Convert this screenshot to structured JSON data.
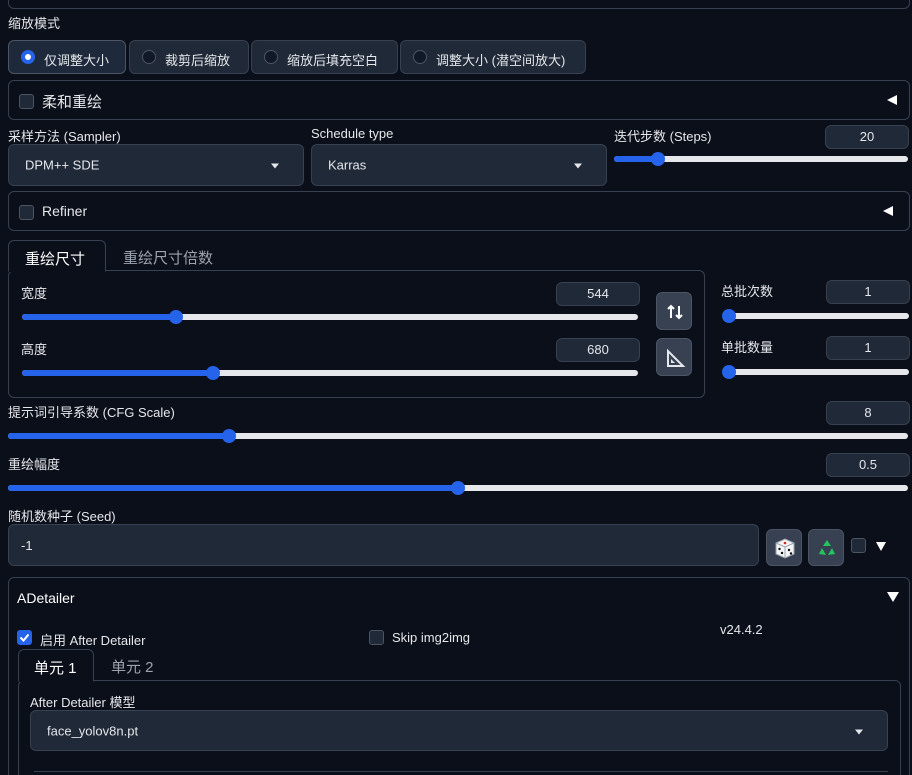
{
  "resize_mode": {
    "label": "缩放模式",
    "options": [
      "仅调整大小",
      "裁剪后缩放",
      "缩放后填充空白",
      "调整大小 (潜空间放大)"
    ],
    "selected": 0
  },
  "soft_inpaint": {
    "label": "柔和重绘",
    "checked": false
  },
  "sampler": {
    "label": "采样方法 (Sampler)",
    "value": "DPM++ SDE"
  },
  "schedule": {
    "label": "Schedule type",
    "value": "Karras"
  },
  "steps": {
    "label": "迭代步数 (Steps)",
    "value": "20",
    "fraction": 0.15
  },
  "refiner": {
    "label": "Refiner",
    "checked": false
  },
  "size_tabs": {
    "tab1": "重绘尺寸",
    "tab2": "重绘尺寸倍数"
  },
  "width": {
    "label": "宽度",
    "value": "544",
    "fraction": 0.25
  },
  "height": {
    "label": "高度",
    "value": "680",
    "fraction": 0.31
  },
  "batch_count": {
    "label": "总批次数",
    "value": "1",
    "fraction": 0
  },
  "batch_size": {
    "label": "单批数量",
    "value": "1",
    "fraction": 0
  },
  "cfg": {
    "label": "提示词引导系数 (CFG Scale)",
    "value": "8",
    "fraction": 0.245
  },
  "denoise": {
    "label": "重绘幅度",
    "value": "0.5",
    "fraction": 0.5
  },
  "seed": {
    "label": "随机数种子 (Seed)",
    "value": "-1"
  },
  "adetailer": {
    "title": "ADetailer",
    "enable_label": "启用 After Detailer",
    "skip_label": "Skip img2img",
    "version": "v24.4.2",
    "tab1": "单元 1",
    "tab2": "单元 2",
    "model_label": "After Detailer 模型",
    "model_value": "face_yolov8n.pt"
  },
  "colors": {
    "accent": "#2563eb",
    "background": "#0b0f19",
    "panel": "#1f2937",
    "recycle": "#22c55e"
  }
}
